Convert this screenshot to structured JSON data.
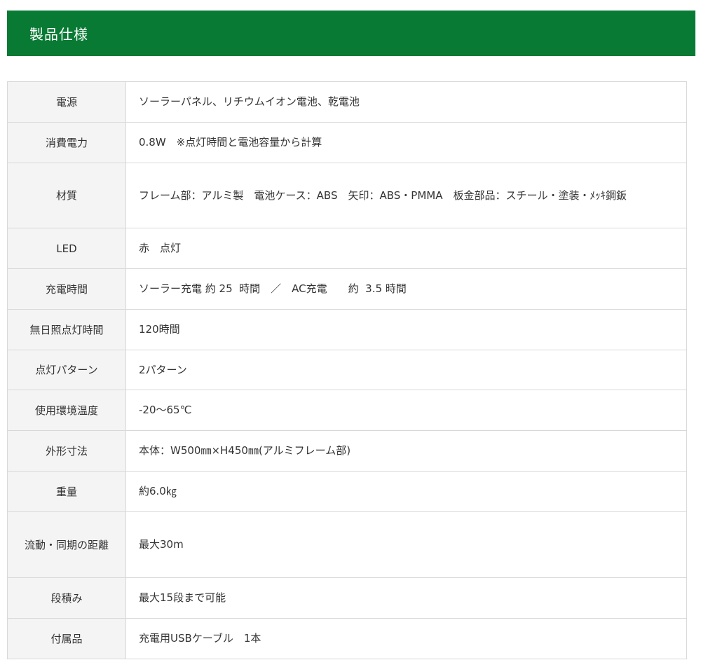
{
  "header": {
    "title": "製品仕様",
    "color": "#087a34"
  },
  "specs": [
    {
      "label": "電源",
      "value": "ソーラーパネル、リチウムイオン電池、乾電池"
    },
    {
      "label": "消費電力",
      "value": "0.8W　※点灯時間と電池容量から計算"
    },
    {
      "label": "材質",
      "value": "フレーム部：アルミ製　電池ケース：ABS　矢印：ABS・PMMA　板金部品：スチール・塗装・ﾒｯｷ鋼鈑"
    },
    {
      "label": "LED",
      "value": "赤　点灯"
    },
    {
      "label": "充電時間",
      "value": "ソーラー充電 約 25  時間　／　AC充電　　約  3.5 時間"
    },
    {
      "label": "無日照点灯時間",
      "value": "120時間"
    },
    {
      "label": "点灯パターン",
      "value": "2パターン"
    },
    {
      "label": "使用環境温度",
      "value": "-20～65℃"
    },
    {
      "label": "外形寸法",
      "value": "本体：W500㎜×H450㎜(アルミフレーム部)"
    },
    {
      "label": "重量",
      "value": "約6.0㎏"
    },
    {
      "label": "流動・同期の距離",
      "value": "最大30m"
    },
    {
      "label": "段積み",
      "value": "最大15段まで可能"
    },
    {
      "label": "付属品",
      "value": "充電用USBケーブル　1本"
    }
  ]
}
